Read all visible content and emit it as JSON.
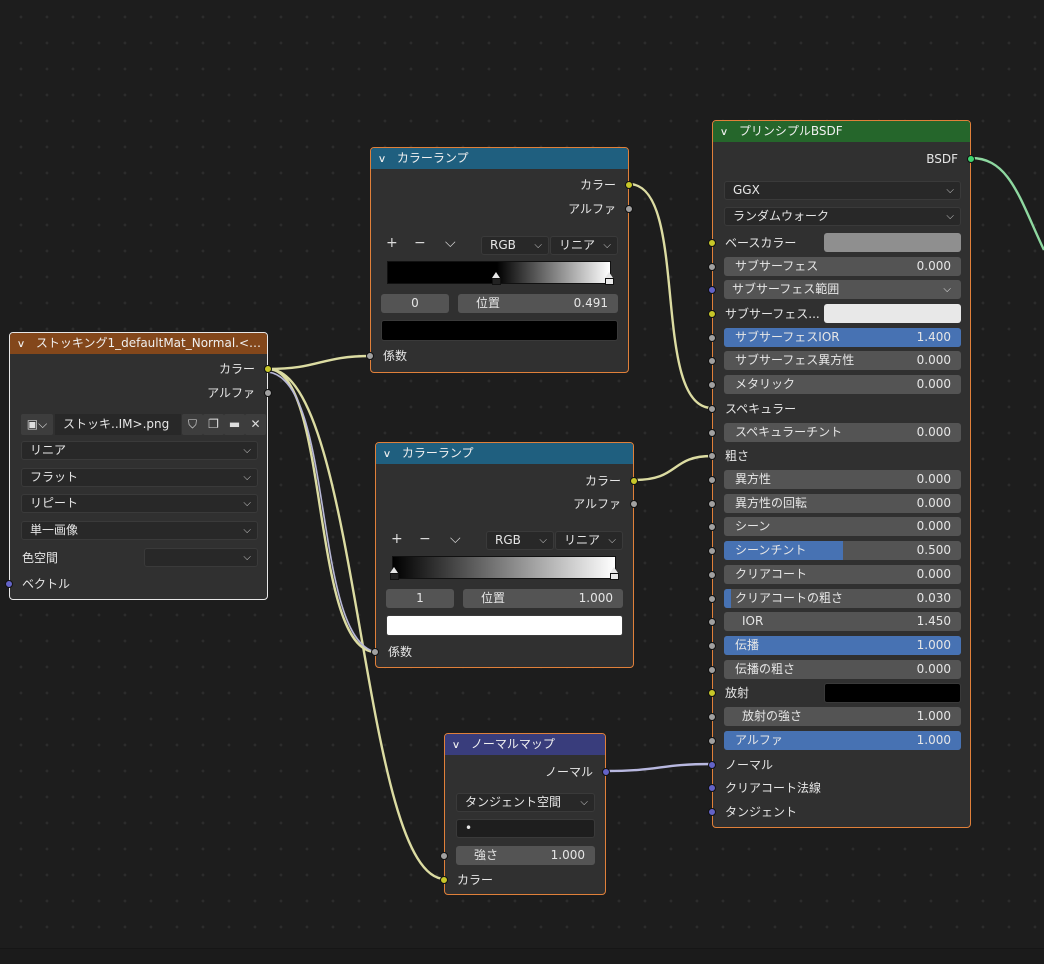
{
  "image_node": {
    "title": "ストッキング1_defaultMat_Normal.<UDI...",
    "outputs": [
      "カラー",
      "アルファ"
    ],
    "filename": "ストッキ..IM>.png",
    "interpolation": "リニア",
    "projection": "フラット",
    "extension": "リピート",
    "source": "単一画像",
    "colorspace_label": "色空間",
    "colorspace_value": "",
    "input_vector": "ベクトル"
  },
  "ramp1": {
    "title": "カラーランプ",
    "outputs": [
      "カラー",
      "アルファ"
    ],
    "plus": "+",
    "minus": "−",
    "menu": "⌵",
    "mode": "RGB",
    "interp": "リニア",
    "index": "0",
    "pos_label": "位置",
    "pos_value": "0.491",
    "color": "#000000",
    "input_fac": "係数"
  },
  "ramp2": {
    "title": "カラーランプ",
    "outputs": [
      "カラー",
      "アルファ"
    ],
    "plus": "+",
    "minus": "−",
    "menu": "⌵",
    "mode": "RGB",
    "interp": "リニア",
    "index": "1",
    "pos_label": "位置",
    "pos_value": "1.000",
    "color": "#ffffff",
    "input_fac": "係数"
  },
  "normal_map": {
    "title": "ノーマルマップ",
    "output": "ノーマル",
    "space": "タンジェント空間",
    "uv": "•",
    "strength_label": "強さ",
    "strength_value": "1.000",
    "input_color": "カラー"
  },
  "bsdf": {
    "title": "プリンシプルBSDF",
    "output": "BSDF",
    "distribution": "GGX",
    "subsurface_method": "ランダムウォーク",
    "base_color_label": "ベースカラー",
    "base_color": "#8f8f8f",
    "subsurface": {
      "label": "サブサーフェス",
      "value": "0.000"
    },
    "subsurface_radius": "サブサーフェス範囲",
    "subsurface_color_label": "サブサーフェス...",
    "subsurface_color": "#e8e8e8",
    "subsurface_ior": {
      "label": "サブサーフェスIOR",
      "value": "1.400",
      "fill": 1.0
    },
    "subsurface_aniso": {
      "label": "サブサーフェス異方性",
      "value": "0.000"
    },
    "metallic": {
      "label": "メタリック",
      "value": "0.000"
    },
    "specular_label": "スペキュラー",
    "specular_tint": {
      "label": "スペキュラーチント",
      "value": "0.000"
    },
    "roughness_label": "粗さ",
    "anisotropic": {
      "label": "異方性",
      "value": "0.000"
    },
    "aniso_rotation": {
      "label": "異方性の回転",
      "value": "0.000"
    },
    "sheen": {
      "label": "シーン",
      "value": "0.000"
    },
    "sheen_tint": {
      "label": "シーンチント",
      "value": "0.500",
      "fill": 0.5
    },
    "clearcoat": {
      "label": "クリアコート",
      "value": "0.000"
    },
    "clearcoat_rough": {
      "label": "クリアコートの粗さ",
      "value": "0.030",
      "fill": 0.03
    },
    "ior": {
      "label": "IOR",
      "value": "1.450"
    },
    "transmission": {
      "label": "伝播",
      "value": "1.000",
      "fill": 1.0
    },
    "transmission_rough": {
      "label": "伝播の粗さ",
      "value": "0.000"
    },
    "emission_label": "放射",
    "emission_color": "#000000",
    "emission_strength": {
      "label": "放射の強さ",
      "value": "1.000"
    },
    "alpha": {
      "label": "アルファ",
      "value": "1.000",
      "fill": 1.0
    },
    "normal_label": "ノーマル",
    "clearcoat_normal_label": "クリアコート法線",
    "tangent_label": "タンジェント"
  },
  "colors": {
    "header_converter": "#1f5f7f",
    "header_texture": "#83471b",
    "header_shader": "#25662b",
    "header_vector": "#393d7c",
    "slider_fill": "#4772b3",
    "socket_color": "#c7c729",
    "socket_float": "#a1a1a1",
    "socket_vector": "#6363c7",
    "socket_shader": "#3fd470"
  }
}
